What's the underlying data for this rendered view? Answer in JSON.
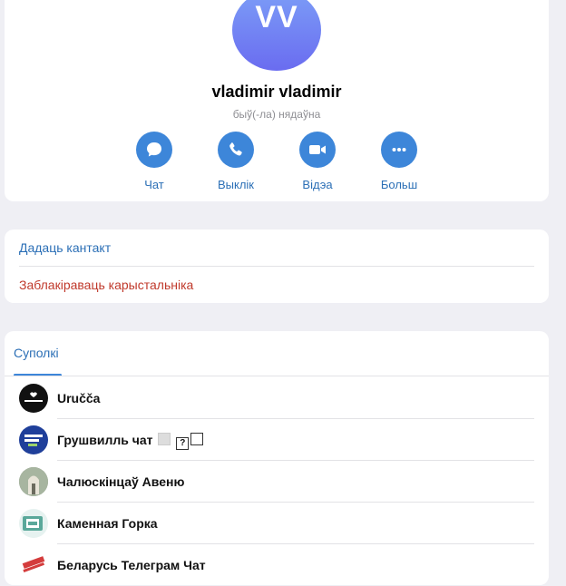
{
  "profile": {
    "initials": "VV",
    "name": "vladimir vladimir",
    "status": "быў(-ла) нядаўна"
  },
  "actions": [
    {
      "label": "Чат",
      "icon": "chat-bubble-icon"
    },
    {
      "label": "Выклік",
      "icon": "phone-icon"
    },
    {
      "label": "Відэа",
      "icon": "video-camera-icon"
    },
    {
      "label": "Больш",
      "icon": "more-dots-icon"
    }
  ],
  "contact_actions": {
    "add_contact": "Дадаць кантакт",
    "block_user": "Заблакіраваць карыстальніка"
  },
  "groups_tab": {
    "label": "Суполкі"
  },
  "groups": [
    {
      "name": "Uručča"
    },
    {
      "name": "Грушвилль чат"
    },
    {
      "name": "Чалюскінцаў Авеню"
    },
    {
      "name": "Каменная Горка"
    },
    {
      "name": "Беларусь Телеграм Чат"
    }
  ],
  "colors": {
    "accent": "#3d86d9",
    "link": "#2b6fb6",
    "danger": "#c0392b",
    "background": "#efeff4"
  }
}
